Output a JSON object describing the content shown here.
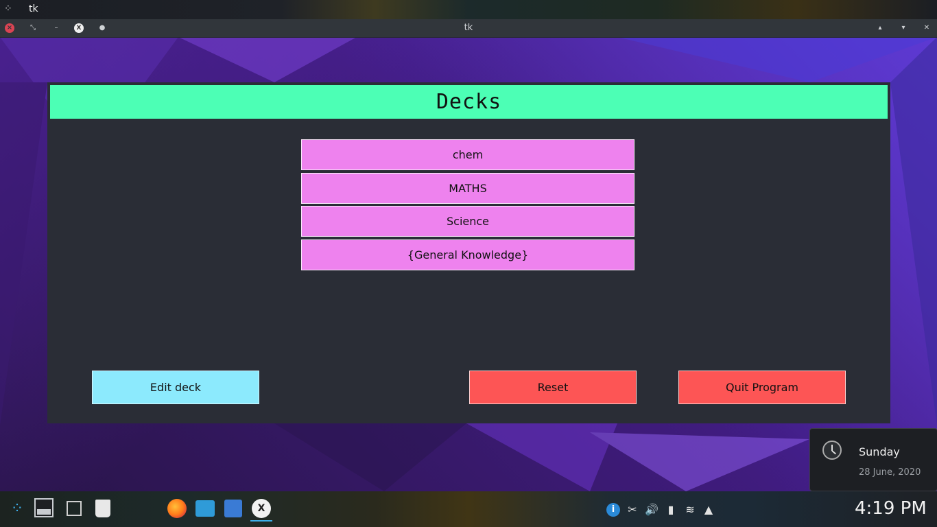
{
  "top_panel": {
    "app_title": "tk"
  },
  "window": {
    "title": "tk",
    "app_glyph": "X"
  },
  "app": {
    "header": "Decks",
    "decks": [
      "chem",
      "MATHS",
      "Science",
      "{General Knowledge}"
    ],
    "buttons": {
      "edit": "Edit deck",
      "reset": "Reset",
      "quit": "Quit Program"
    },
    "colors": {
      "header_bg": "#4cffb5",
      "deck_bg": "#ee82ee",
      "edit_bg": "#8ceafd",
      "danger_bg": "#fd5555",
      "window_bg": "#2a2d36"
    }
  },
  "notification": {
    "day": "Sunday",
    "date": "28 June, 2020"
  },
  "taskbar": {
    "clock": "4:19 PM",
    "apps": [
      "launcher-icon",
      "show-desktop-icon",
      "terminal-icon",
      "trash-icon",
      "firefox-icon",
      "file-manager-icon",
      "vscode-icon",
      "x-app-icon"
    ],
    "tray": [
      "info-icon",
      "scissors-icon",
      "volume-icon",
      "battery-icon",
      "wifi-icon",
      "arrow-up-icon"
    ]
  }
}
